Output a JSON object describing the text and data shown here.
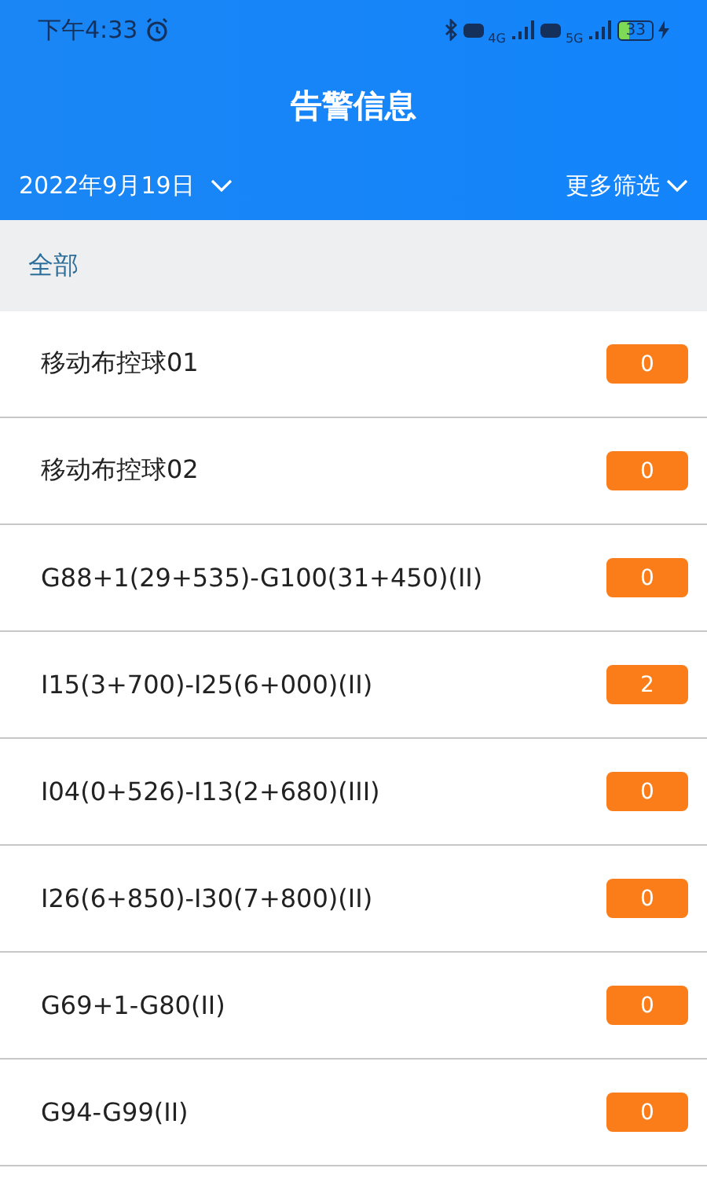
{
  "status_bar": {
    "time": "下午4:33",
    "network_1": "4G",
    "network_2": "5G",
    "battery": "33"
  },
  "title": "告警信息",
  "filter_bar": {
    "date": "2022年9月19日",
    "more": "更多筛选"
  },
  "category": {
    "label": "全部"
  },
  "rows": [
    {
      "name": "移动布控球01",
      "count": "0"
    },
    {
      "name": "移动布控球02",
      "count": "0"
    },
    {
      "name": "G88+1(29+535)-G100(31+450)(II)",
      "count": "0"
    },
    {
      "name": "I15(3+700)-I25(6+000)(II)",
      "count": "2"
    },
    {
      "name": "I04(0+526)-I13(2+680)(III)",
      "count": "0"
    },
    {
      "name": "I26(6+850)-I30(7+800)(II)",
      "count": "0"
    },
    {
      "name": "G69+1-G80(II)",
      "count": "0"
    },
    {
      "name": "G94-G99(II)",
      "count": "0"
    }
  ]
}
